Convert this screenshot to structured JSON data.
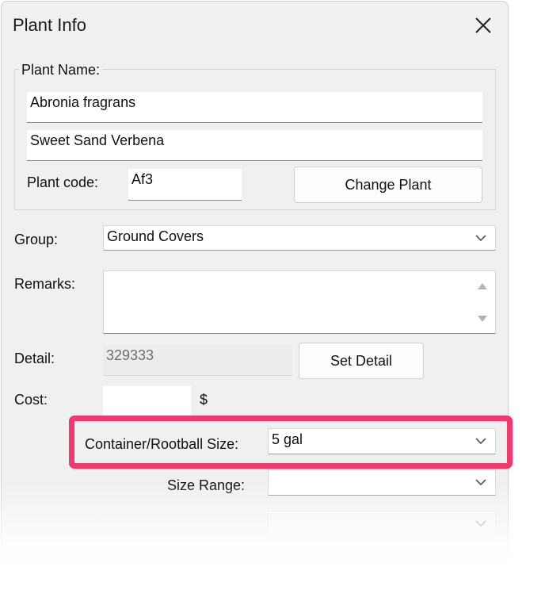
{
  "window": {
    "title": "Plant Info"
  },
  "plant_name": {
    "group_label": "Plant Name:",
    "botanical_name": "Abronia fragrans",
    "common_name": "Sweet Sand Verbena",
    "code_label": "Plant code:",
    "code_value": "Af3",
    "change_button": "Change Plant"
  },
  "group": {
    "label": "Group:",
    "value": "Ground Covers"
  },
  "remarks": {
    "label": "Remarks:",
    "value": ""
  },
  "detail": {
    "label": "Detail:",
    "value": "329333",
    "set_button": "Set Detail"
  },
  "cost": {
    "label": "Cost:",
    "value": "",
    "currency": "$"
  },
  "container": {
    "label": "Container/Rootball Size:",
    "value": "5 gal"
  },
  "size_range": {
    "label": "Size Range:",
    "value": ""
  },
  "extra_dropdown": {
    "value": ""
  },
  "colors": {
    "highlight": "#f2386f",
    "dialog_bg": "#f0f0f0"
  }
}
